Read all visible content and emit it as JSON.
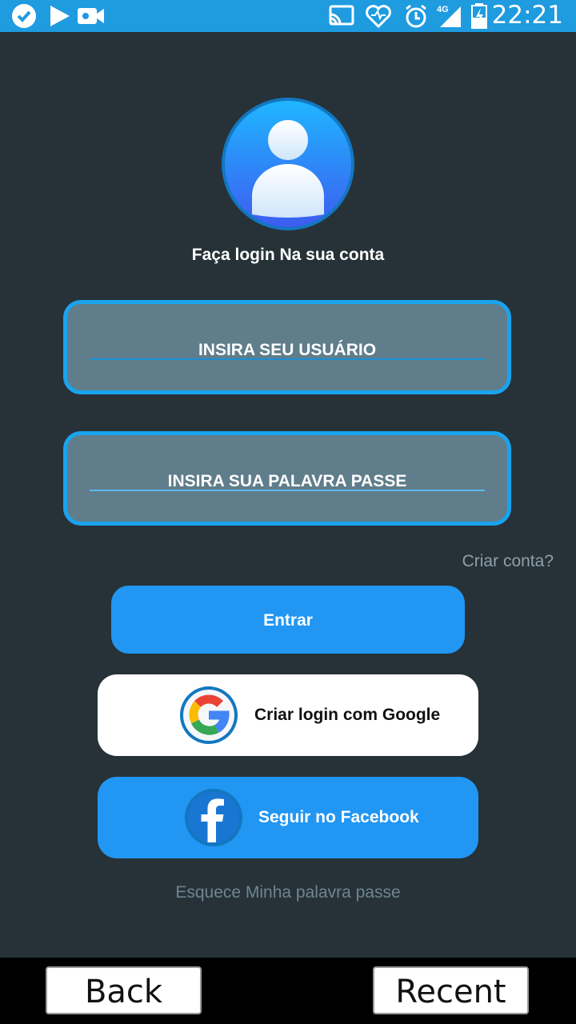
{
  "status_bar": {
    "time": "22:21",
    "network": "4G",
    "icons": [
      "check-circle-icon",
      "play-icon",
      "video-camera-icon",
      "cast-icon",
      "heart-monitor-icon",
      "alarm-icon",
      "signal-icon",
      "battery-icon"
    ]
  },
  "login": {
    "avatar_icon": "user-avatar-icon",
    "title": "Faça login Na sua conta",
    "username_placeholder": "INSIRA SEU USUÁRIO",
    "password_placeholder": "INSIRA SUA PALAVRA PASSE",
    "create_account": "Criar conta?",
    "enter_button": "Entrar",
    "google_button": "Criar login com Google",
    "facebook_button": "Seguir no Facebook",
    "forgot_password": "Esquece Minha palavra passe"
  },
  "nav": {
    "back": "Back",
    "recent": "Recent"
  },
  "colors": {
    "background": "#263238",
    "accent": "#2196f3",
    "field": "#607d8b",
    "status_bar": "#1f9be0"
  }
}
